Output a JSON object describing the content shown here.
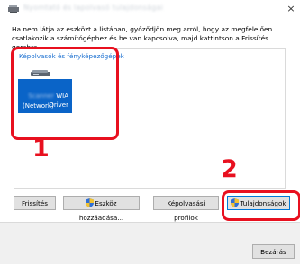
{
  "window": {
    "title": "Nyomtató és lapolvasó tulajdonságai",
    "close_glyph": "×"
  },
  "instruction": "Ha nem látja az eszközt a listában, győződjön meg arról, hogy az megfelelően csatlakozik a számítógéphez és be van kapcsolva, majd kattintson a Frissítés gombra.",
  "group": {
    "label": "Képolvasók és fényképezőgépek"
  },
  "device": {
    "name_hidden": "Scanner",
    "line1": "WIA Driver",
    "line2": "(Network)",
    "tile_color": "#0a64c8"
  },
  "callouts": {
    "first": "1",
    "second": "2",
    "color": "#e8101f"
  },
  "buttons": {
    "refresh": "Frissítés",
    "add_device": "Eszköz hozzáadása...",
    "scan_profiles": "Képolvasási profilok",
    "properties": "Tulajdonságok",
    "close": "Bezárás"
  }
}
